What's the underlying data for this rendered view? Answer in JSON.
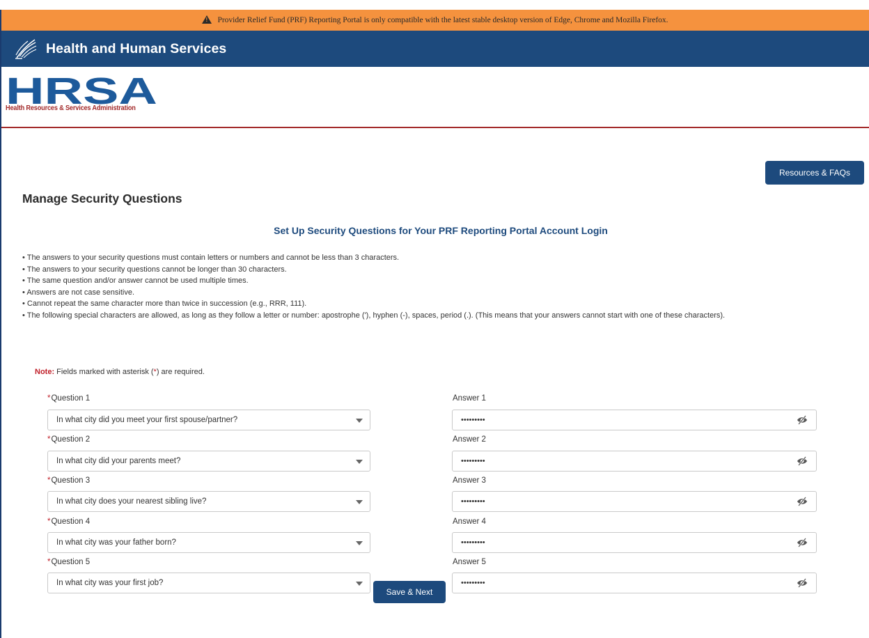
{
  "banner": {
    "warning_text": "Provider Relief Fund (PRF) Reporting Portal is only compatible with the latest stable desktop version of Edge, Chrome and Mozilla Firefox.",
    "warning_icon": "warning-triangle-icon"
  },
  "hhs": {
    "title": "Health and Human Services",
    "logo_icon": "hhs-eagle-logo"
  },
  "hrsa": {
    "logo_text": "HRSA",
    "subtitle": "Health Resources & Services Administration"
  },
  "resources_button": "Resources & FAQs",
  "page_title": "Manage Security Questions",
  "section_title": "Set Up Security Questions for Your PRF Reporting Portal Account Login",
  "rules": [
    "The answers to your security questions must contain letters or numbers and cannot be less than 3 characters.",
    "The answers to your security questions cannot be longer than 30 characters.",
    "The same question and/or answer cannot be used multiple times.",
    "Answers are not case sensitive.",
    "Cannot repeat the same character more than twice in succession (e.g., RRR, 111).",
    "The following special characters are allowed, as long as they follow a letter or number: apostrophe ('), hyphen (-), spaces, period (.). (This means that your answers cannot start with one of these characters)."
  ],
  "note": {
    "label": "Note:",
    "text_before": "Fields marked with asterisk (",
    "asterisk": "*",
    "text_after": ") are required."
  },
  "questions": [
    {
      "label": "Question 1",
      "value": "In what city did you meet your first spouse/partner?",
      "answer_label": "Answer 1",
      "answer_value": "•••••••••"
    },
    {
      "label": "Question 2",
      "value": "In what city did your parents meet?",
      "answer_label": "Answer 2",
      "answer_value": "•••••••••"
    },
    {
      "label": "Question 3",
      "value": "In what city does your nearest sibling live?",
      "answer_label": "Answer 3",
      "answer_value": "•••••••••"
    },
    {
      "label": "Question 4",
      "value": "In what city was your father born?",
      "answer_label": "Answer 4",
      "answer_value": "•••••••••"
    },
    {
      "label": "Question 5",
      "value": "In what city was your first job?",
      "answer_label": "Answer 5",
      "answer_value": "•••••••••"
    }
  ],
  "required_marker": "*",
  "save_button": "Save & Next",
  "colors": {
    "banner": "#f5923e",
    "hhs_bar": "#1d4a7d",
    "hrsa_blue": "#1d5a9b",
    "hrsa_red": "#a32a2a",
    "required": "#c0202a"
  }
}
